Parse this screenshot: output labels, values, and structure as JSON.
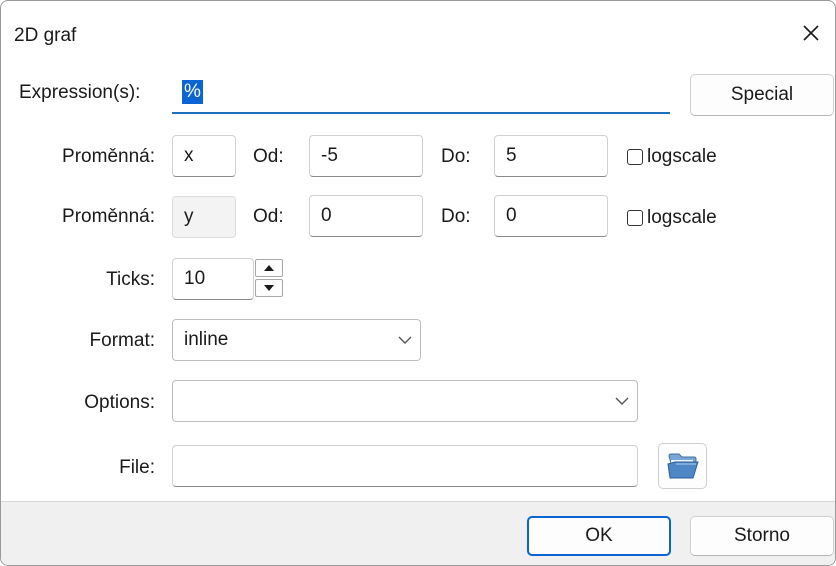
{
  "window": {
    "title": "2D graf"
  },
  "expression": {
    "label": "Expression(s):",
    "value": "%"
  },
  "buttons": {
    "special": "Special",
    "ok": "OK",
    "cancel": "Storno"
  },
  "var1": {
    "label": "Proměnná:",
    "name": "x",
    "from_label": "Od:",
    "from": "-5",
    "to_label": "Do:",
    "to": "5",
    "logscale_label": "logscale",
    "logscale": false
  },
  "var2": {
    "label": "Proměnná:",
    "name": "y",
    "from_label": "Od:",
    "from": "0",
    "to_label": "Do:",
    "to": "0",
    "logscale_label": "logscale",
    "logscale": false
  },
  "ticks": {
    "label": "Ticks:",
    "value": "10"
  },
  "format": {
    "label": "Format:",
    "value": "inline"
  },
  "options": {
    "label": "Options:",
    "value": ""
  },
  "file": {
    "label": "File:",
    "value": ""
  },
  "icons": {
    "close": "close-icon",
    "folder": "folder-open-icon",
    "dropdown": "chevron-down-icon"
  }
}
